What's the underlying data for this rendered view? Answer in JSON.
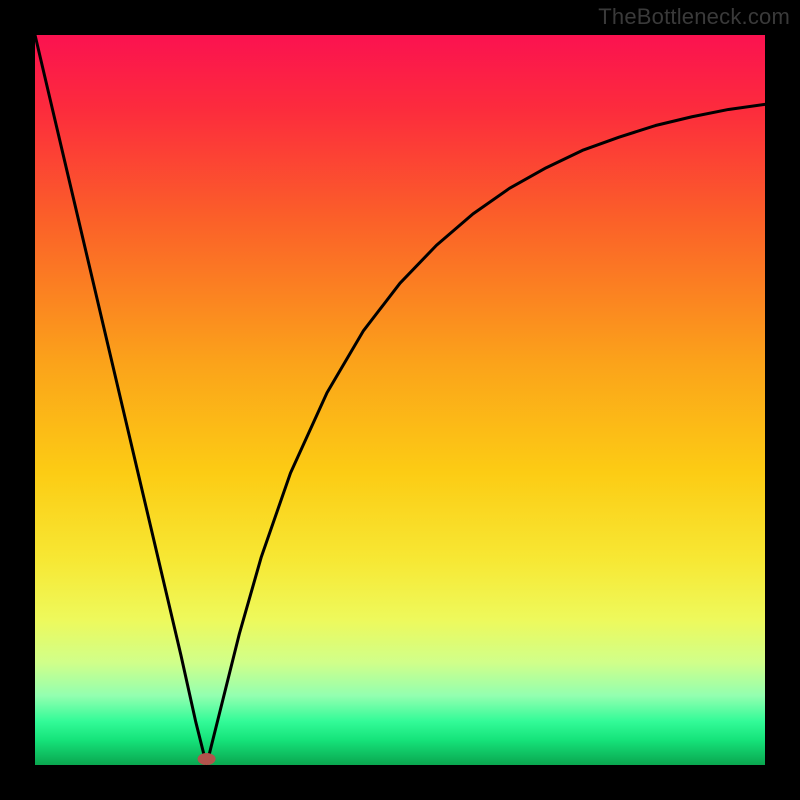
{
  "watermark": "TheBottleneck.com",
  "colors": {
    "frame": "#000000",
    "curve": "#000000",
    "marker_fill": "#b2534c",
    "gradient_stops": [
      {
        "offset": 0.0,
        "color": "#fb1250"
      },
      {
        "offset": 0.1,
        "color": "#fc2b3d"
      },
      {
        "offset": 0.25,
        "color": "#fb5f29"
      },
      {
        "offset": 0.45,
        "color": "#fba31a"
      },
      {
        "offset": 0.6,
        "color": "#fccc14"
      },
      {
        "offset": 0.72,
        "color": "#f7e834"
      },
      {
        "offset": 0.8,
        "color": "#eef95b"
      },
      {
        "offset": 0.86,
        "color": "#d0ff8a"
      },
      {
        "offset": 0.905,
        "color": "#93ffb0"
      },
      {
        "offset": 0.94,
        "color": "#33fb98"
      },
      {
        "offset": 0.965,
        "color": "#16e47b"
      },
      {
        "offset": 1.0,
        "color": "#0aa64f"
      }
    ]
  },
  "chart_data": {
    "type": "line",
    "title": "",
    "xlabel": "",
    "ylabel": "",
    "x": [
      0.0,
      0.02,
      0.04,
      0.06,
      0.08,
      0.1,
      0.12,
      0.14,
      0.16,
      0.18,
      0.2,
      0.22,
      0.235,
      0.25,
      0.28,
      0.31,
      0.35,
      0.4,
      0.45,
      0.5,
      0.55,
      0.6,
      0.65,
      0.7,
      0.75,
      0.8,
      0.85,
      0.9,
      0.95,
      1.0
    ],
    "values": [
      1.0,
      0.915,
      0.83,
      0.745,
      0.66,
      0.575,
      0.49,
      0.405,
      0.32,
      0.235,
      0.15,
      0.06,
      0.0,
      0.06,
      0.18,
      0.285,
      0.4,
      0.51,
      0.595,
      0.66,
      0.712,
      0.755,
      0.79,
      0.818,
      0.842,
      0.86,
      0.876,
      0.888,
      0.898,
      0.905
    ],
    "xlim": [
      0,
      1
    ],
    "ylim": [
      0,
      1
    ],
    "marker": {
      "x": 0.235,
      "y": 0.0
    },
    "grid": false,
    "legend": false
  }
}
